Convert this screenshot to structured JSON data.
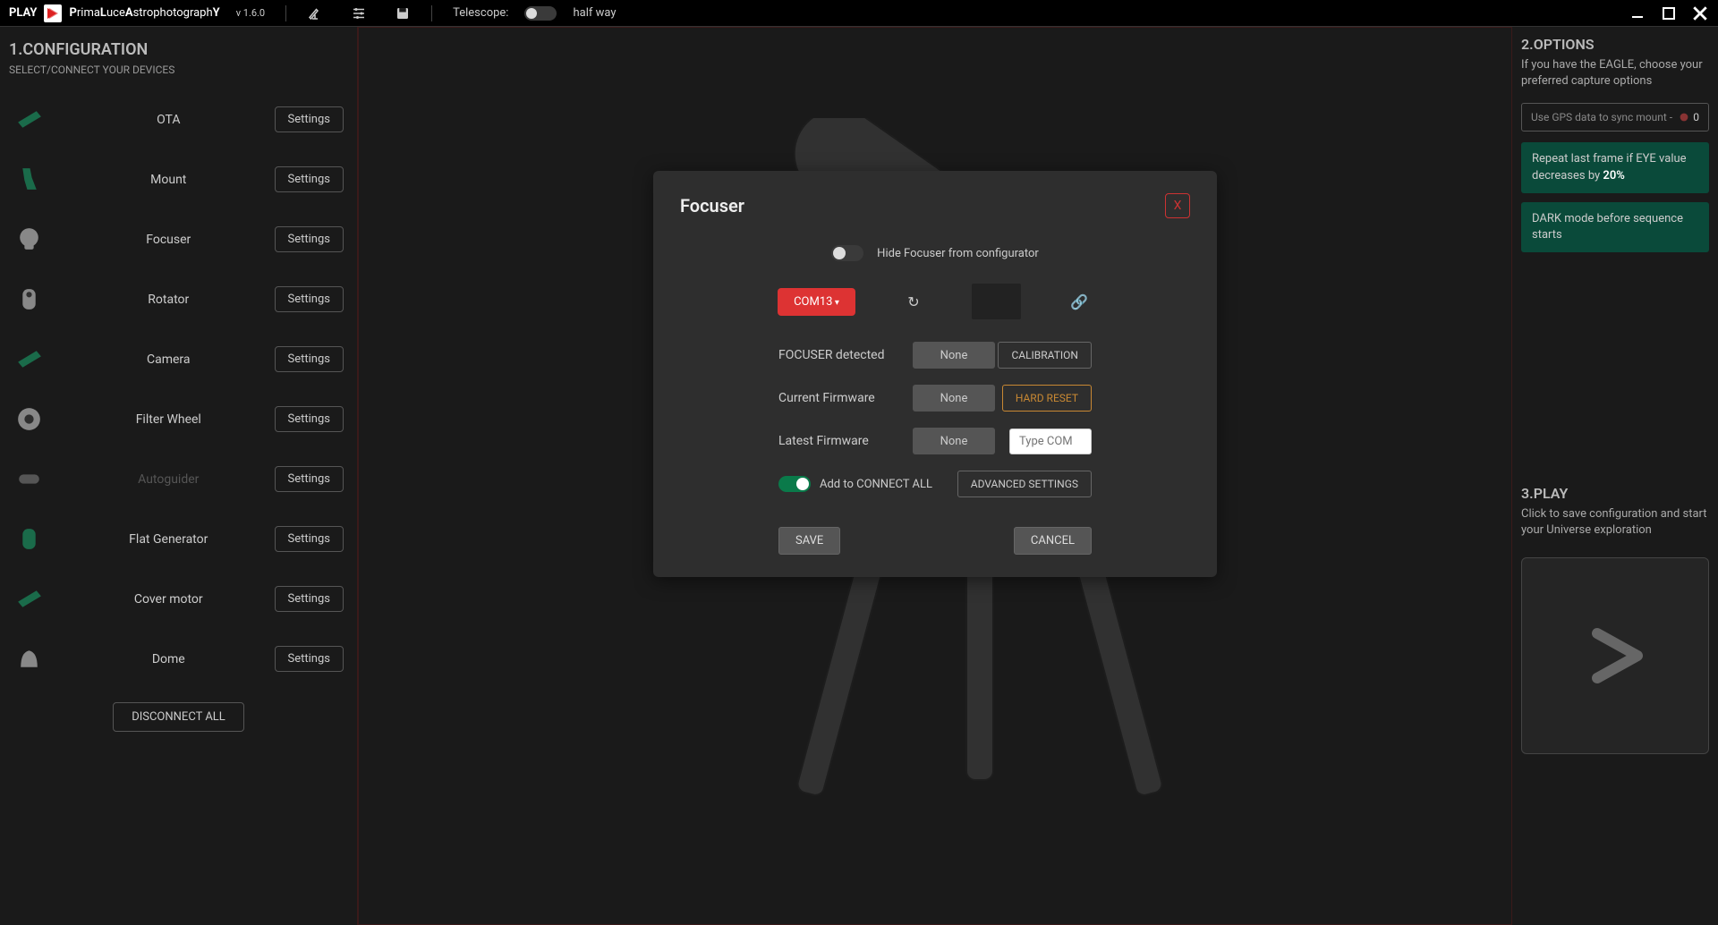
{
  "topbar": {
    "play_label": "PLAY",
    "app_name_parts": [
      "P",
      "rima",
      "L",
      "uce",
      "A",
      "strophotograph",
      "Y"
    ],
    "version": "v 1.6.0",
    "telescope_label": "Telescope:",
    "status": "half way"
  },
  "left": {
    "title": "1.CONFIGURATION",
    "subtitle": "SELECT/CONNECT YOUR DEVICES",
    "settings_label": "Settings",
    "disconnect": "DISCONNECT ALL",
    "devices": [
      {
        "name": "OTA",
        "enabled": true,
        "icon_color": "#1a6b4a"
      },
      {
        "name": "Mount",
        "enabled": true,
        "icon_color": "#1a6b4a"
      },
      {
        "name": "Focuser",
        "enabled": true,
        "icon_color": "#888"
      },
      {
        "name": "Rotator",
        "enabled": true,
        "icon_color": "#888"
      },
      {
        "name": "Camera",
        "enabled": true,
        "icon_color": "#1a6b4a"
      },
      {
        "name": "Filter Wheel",
        "enabled": true,
        "icon_color": "#888"
      },
      {
        "name": "Autoguider",
        "enabled": false,
        "icon_color": "#555"
      },
      {
        "name": "Flat Generator",
        "enabled": true,
        "icon_color": "#1a6b4a"
      },
      {
        "name": "Cover motor",
        "enabled": true,
        "icon_color": "#1a6b4a"
      },
      {
        "name": "Dome",
        "enabled": true,
        "icon_color": "#888"
      }
    ]
  },
  "modal": {
    "title": "Focuser",
    "close": "X",
    "hide_label": "Hide Focuser from configurator",
    "hide_on": false,
    "com_port": "COM13",
    "detected_label": "FOCUSER detected",
    "detected_value": "None",
    "calibration": "CALIBRATION",
    "current_fw_label": "Current Firmware",
    "current_fw_value": "None",
    "hard_reset": "HARD RESET",
    "latest_fw_label": "Latest Firmware",
    "latest_fw_value": "None",
    "com_placeholder": "Type COM",
    "connect_all_label": "Add to CONNECT ALL",
    "connect_all_on": true,
    "advanced": "ADVANCED SETTINGS",
    "save": "SAVE",
    "cancel": "CANCEL"
  },
  "right": {
    "options_title": "2.OPTIONS",
    "options_text": "If you have the EAGLE, choose your preferred capture options",
    "gps_text": "Use GPS data to sync mount  -",
    "gps_badge": "0",
    "repeat_pre": "Repeat last frame if EYE value decreases by ",
    "repeat_bold": "20%",
    "dark_mode": "DARK mode before sequence starts",
    "play_title": "3.PLAY",
    "play_text": "Click to save configuration and start your Universe exploration"
  }
}
